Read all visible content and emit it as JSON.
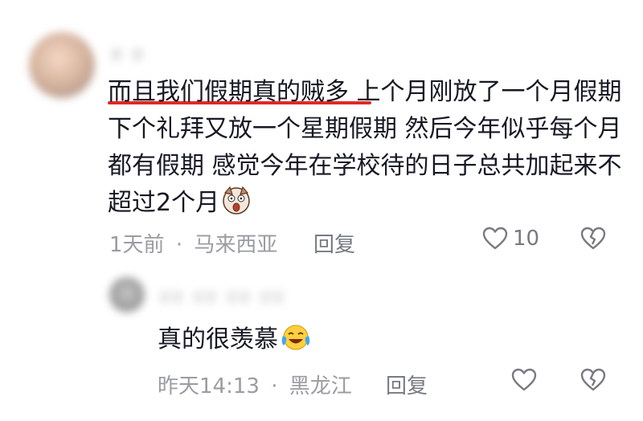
{
  "comment": {
    "username": "ಠ ಠ",
    "text": "而且我们假期真的贼多  上个月刚放了一个月假期  下个礼拜又放一个星期假期    然后今年似乎每个月都有假期    感觉今年在学校待的日子总共加起来不超过2个月",
    "emoji": "dog-shocked-emoji",
    "time": "1天前",
    "separator": "·",
    "location": "马来西亚",
    "reply_label": "回复",
    "like_count": "10"
  },
  "reply": {
    "username": "ಠಠ ಠಠ ಠಠ ಠಠ",
    "text": "真的很羡慕",
    "emoji": "crying-laugh-emoji",
    "time": "昨天14:13",
    "separator": "·",
    "location": "黑龙江",
    "reply_label": "回复",
    "like_count": ""
  },
  "colors": {
    "underline": "#e22828",
    "text": "#161823",
    "meta": "#9a9ca3"
  }
}
